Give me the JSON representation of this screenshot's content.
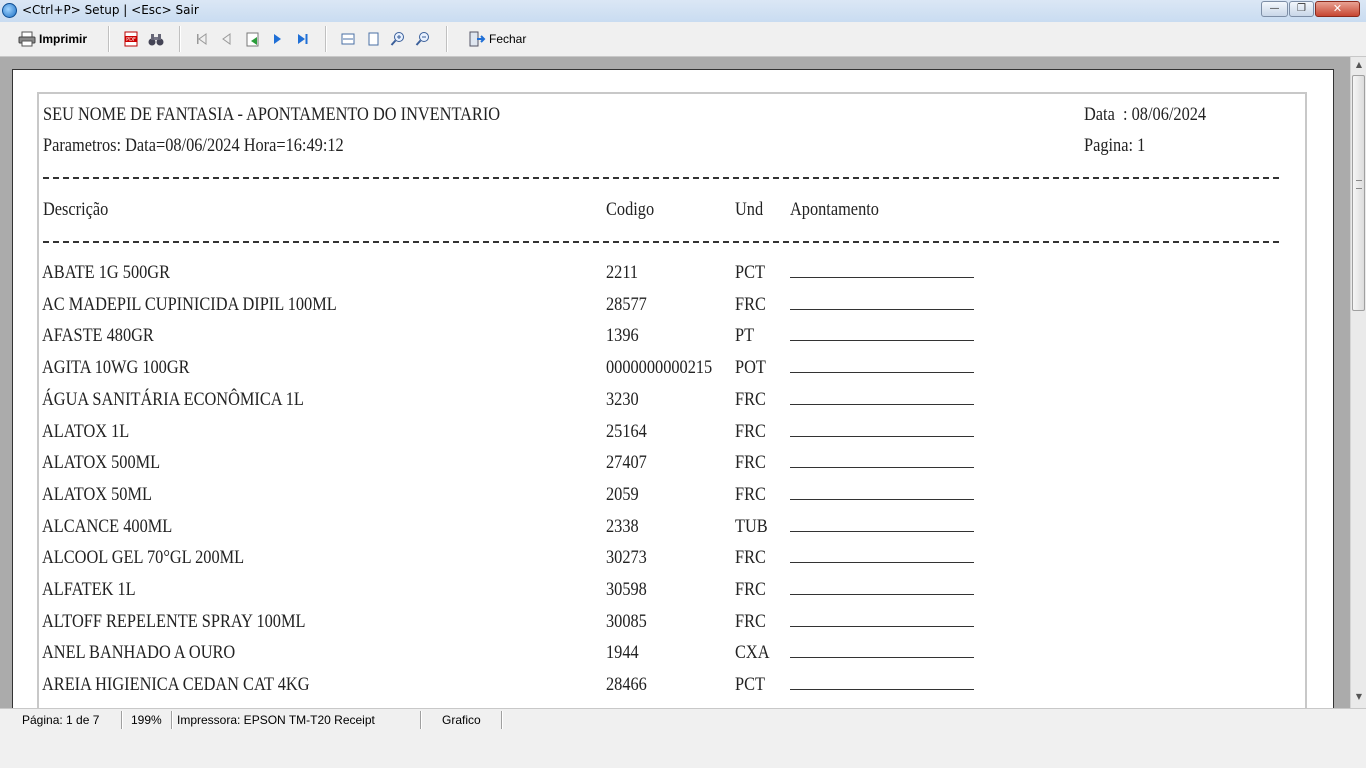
{
  "window": {
    "title": "<Ctrl+P> Setup | <Esc> Sair",
    "controls": {
      "minimize": "—",
      "maximize": "❐",
      "close": "✕"
    }
  },
  "toolbar": {
    "print_label": "Imprimir",
    "close_label": "Fechar",
    "icons": [
      "printer-icon",
      "pdf-icon",
      "binoculars-icon",
      "first-page-icon",
      "prev-page-icon",
      "goto-page-icon",
      "next-page-icon",
      "last-page-icon",
      "page-width-icon",
      "whole-page-icon",
      "zoom-in-icon",
      "zoom-out-icon",
      "exit-icon"
    ]
  },
  "report": {
    "title": "SEU NOME DE FANTASIA - APONTAMENTO DO INVENTARIO",
    "params": "Parametros: Data=08/06/2024 Hora=16:49:12",
    "date_label": "Data  : 08/06/2024",
    "page_label": "Pagina: 1",
    "columns": {
      "desc": "Descrição",
      "code": "Codigo",
      "unit": "Und",
      "count": "Apontamento"
    },
    "rows": [
      {
        "desc": "ABATE 1G 500GR",
        "code": "2211",
        "unit": "PCT"
      },
      {
        "desc": "AC MADEPIL CUPINICIDA DIPIL 100ML",
        "code": "28577",
        "unit": "FRC"
      },
      {
        "desc": "AFASTE 480GR",
        "code": "1396",
        "unit": "PT"
      },
      {
        "desc": "AGITA 10WG 100GR",
        "code": "0000000000215",
        "unit": "POT"
      },
      {
        "desc": "ÁGUA SANITÁRIA ECONÔMICA 1L",
        "code": "3230",
        "unit": "FRC"
      },
      {
        "desc": "ALATOX 1L",
        "code": "25164",
        "unit": "FRC"
      },
      {
        "desc": "ALATOX 500ML",
        "code": "27407",
        "unit": "FRC"
      },
      {
        "desc": "ALATOX 50ML",
        "code": "2059",
        "unit": "FRC"
      },
      {
        "desc": "ALCANCE 400ML",
        "code": "2338",
        "unit": "TUB"
      },
      {
        "desc": "ALCOOL GEL 70°GL 200ML",
        "code": "30273",
        "unit": "FRC"
      },
      {
        "desc": "ALFATEK 1L",
        "code": "30598",
        "unit": "FRC"
      },
      {
        "desc": "ALTOFF REPELENTE SPRAY 100ML",
        "code": "30085",
        "unit": "FRC"
      },
      {
        "desc": "ANEL BANHADO A OURO",
        "code": "1944",
        "unit": "CXA"
      },
      {
        "desc": "AREIA HIGIENICA CEDAN CAT 4KG",
        "code": "28466",
        "unit": "PCT"
      }
    ]
  },
  "status": {
    "page": "Página: 1 de 7",
    "zoom": "199%",
    "printer": "Impressora: EPSON TM-T20 Receipt",
    "mode": "Grafico"
  }
}
